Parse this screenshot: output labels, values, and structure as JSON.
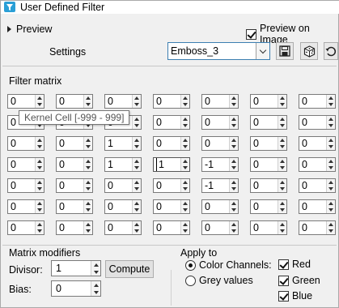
{
  "window": {
    "title": "User Defined Filter",
    "icon": "filter-app-icon"
  },
  "preview": {
    "label": "Preview",
    "expanded": false
  },
  "preview_on_image": {
    "label": "Preview on Image",
    "checked": true
  },
  "settings": {
    "label": "Settings",
    "preset_value": "Emboss_3",
    "tools": [
      "save-icon",
      "random-dice-icon",
      "reset-icon"
    ]
  },
  "filter_matrix": {
    "label": "Filter matrix",
    "rows": [
      [
        "0",
        "0",
        "0",
        "0",
        "0",
        "0",
        "0"
      ],
      [
        "0",
        "0",
        "0",
        "0",
        "0",
        "0",
        "0"
      ],
      [
        "0",
        "0",
        "1",
        "0",
        "0",
        "0",
        "0"
      ],
      [
        "0",
        "0",
        "1",
        "1",
        "-1",
        "0",
        "0"
      ],
      [
        "0",
        "0",
        "0",
        "0",
        "-1",
        "0",
        "0"
      ],
      [
        "0",
        "0",
        "0",
        "0",
        "0",
        "0",
        "0"
      ],
      [
        "0",
        "0",
        "0",
        "0",
        "0",
        "0",
        "0"
      ]
    ],
    "tooltip": "Kernel Cell [-999 - 999]"
  },
  "matrix_modifiers": {
    "label": "Matrix modifiers",
    "divisor_label": "Divisor:",
    "divisor_value": "1",
    "compute_label": "Compute",
    "bias_label": "Bias:",
    "bias_value": "0"
  },
  "apply_to": {
    "label": "Apply to",
    "color_channels_label": "Color Channels:",
    "grey_values_label": "Grey values",
    "selected": "color_channels",
    "channels": [
      {
        "label": "Red",
        "checked": true
      },
      {
        "label": "Green",
        "checked": true
      },
      {
        "label": "Blue",
        "checked": true
      }
    ]
  }
}
